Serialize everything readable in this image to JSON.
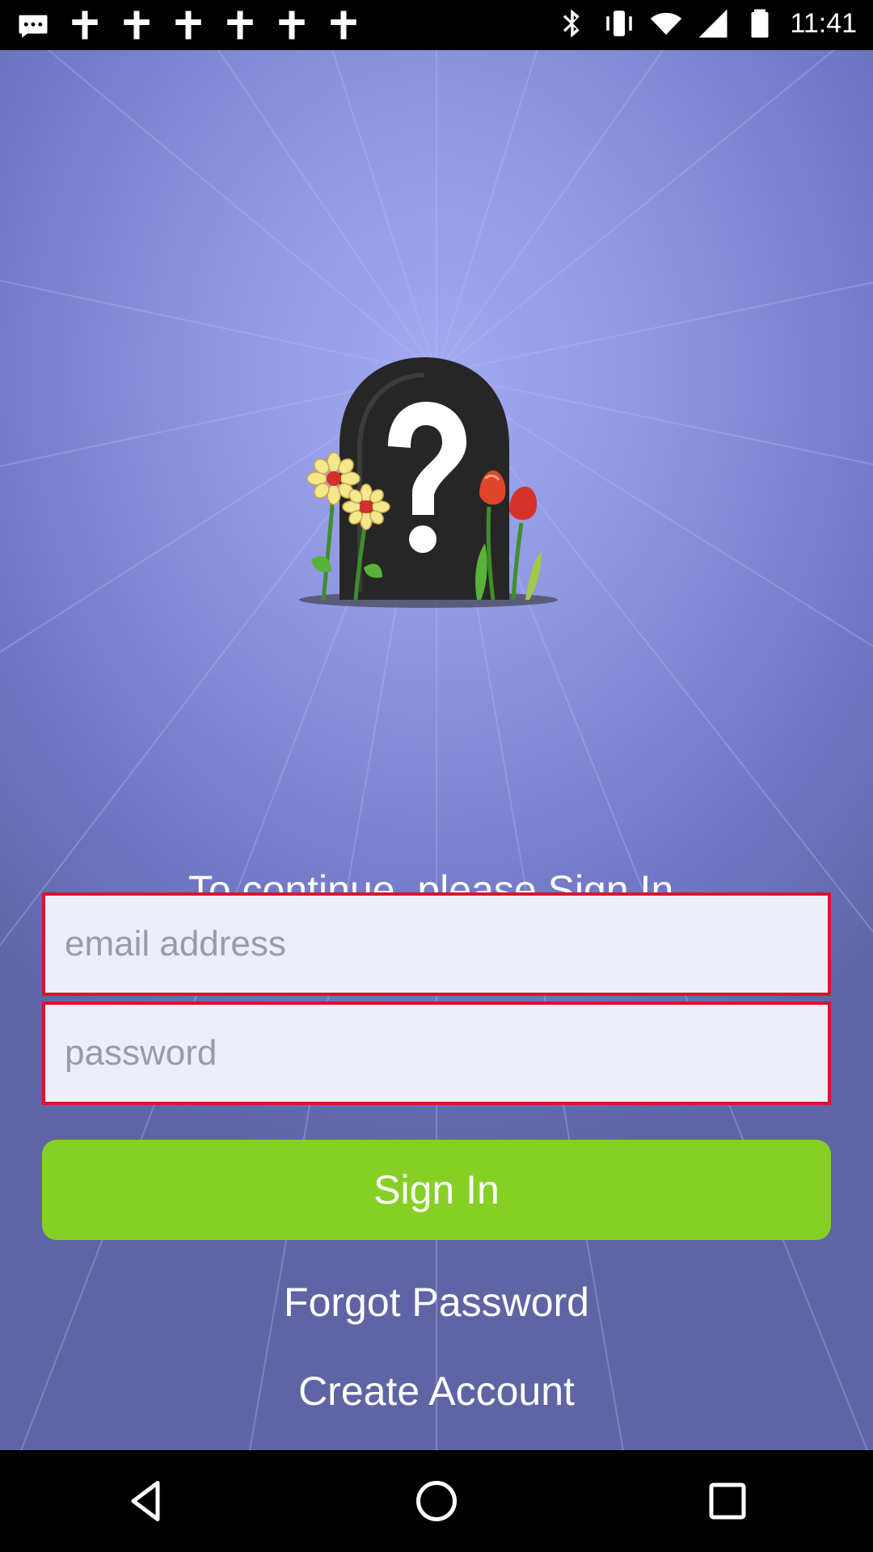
{
  "status_bar": {
    "time": "11:41",
    "left_icons": [
      "message-icon",
      "notification-icon",
      "notification-icon",
      "notification-icon",
      "notification-icon",
      "notification-icon",
      "notification-icon"
    ],
    "right_icons": [
      "bluetooth-icon",
      "vibrate-icon",
      "wifi-icon",
      "signal-icon",
      "battery-icon"
    ]
  },
  "hero": {
    "icon": "question-mark-tombstone-with-flowers"
  },
  "login": {
    "prompt": "To continue, please Sign In.",
    "email_placeholder": "email address",
    "email_value": "",
    "password_placeholder": "password",
    "password_value": "",
    "signin_label": "Sign In",
    "forgot_label": "Forgot Password",
    "create_label": "Create Account"
  },
  "colors": {
    "background_center": "#a3aaf2",
    "background_edge": "#5f64a4",
    "field_border": "#d9152b",
    "field_bg": "#eeeef8",
    "signin_bg": "#86d026"
  },
  "nav_bar": {
    "buttons": [
      "back-icon",
      "home-icon",
      "recents-icon"
    ]
  }
}
